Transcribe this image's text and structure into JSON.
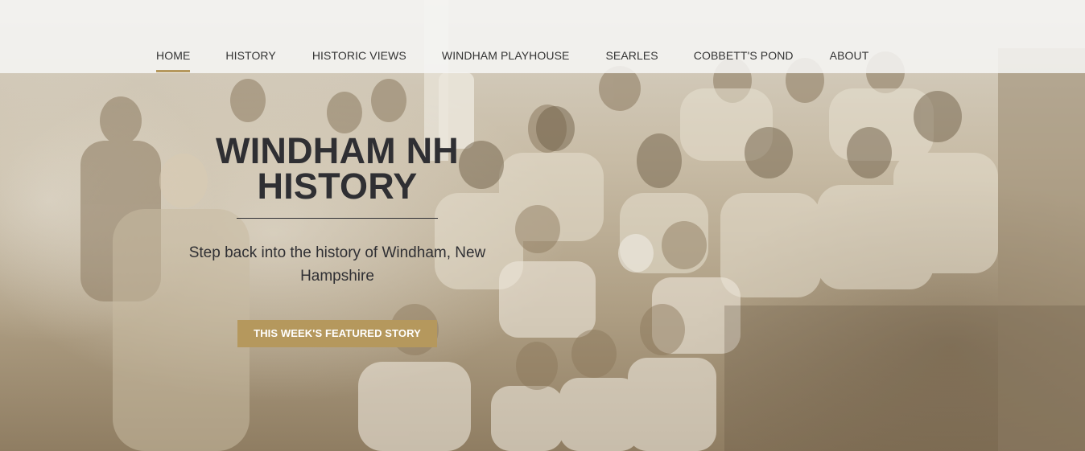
{
  "nav": {
    "items": [
      {
        "label": "HOME"
      },
      {
        "label": "HISTORY"
      },
      {
        "label": "HISTORIC VIEWS"
      },
      {
        "label": "WINDHAM PLAYHOUSE"
      },
      {
        "label": "SEARLES"
      },
      {
        "label": "COBBETT'S POND"
      },
      {
        "label": "ABOUT"
      }
    ],
    "active_item": "HOME"
  },
  "hero": {
    "title_line1": "WINDHAM NH",
    "title_line2": "HISTORY",
    "subtitle": "Step back into the history of Windham, New Hampshire",
    "cta_label": "THIS WEEK'S FEATURED STORY",
    "background_image": "sepia group photograph of families on a porch"
  },
  "colors": {
    "accent": "#b5985d",
    "text": "#2f2f33",
    "nav_background": "#f6f6f4"
  }
}
